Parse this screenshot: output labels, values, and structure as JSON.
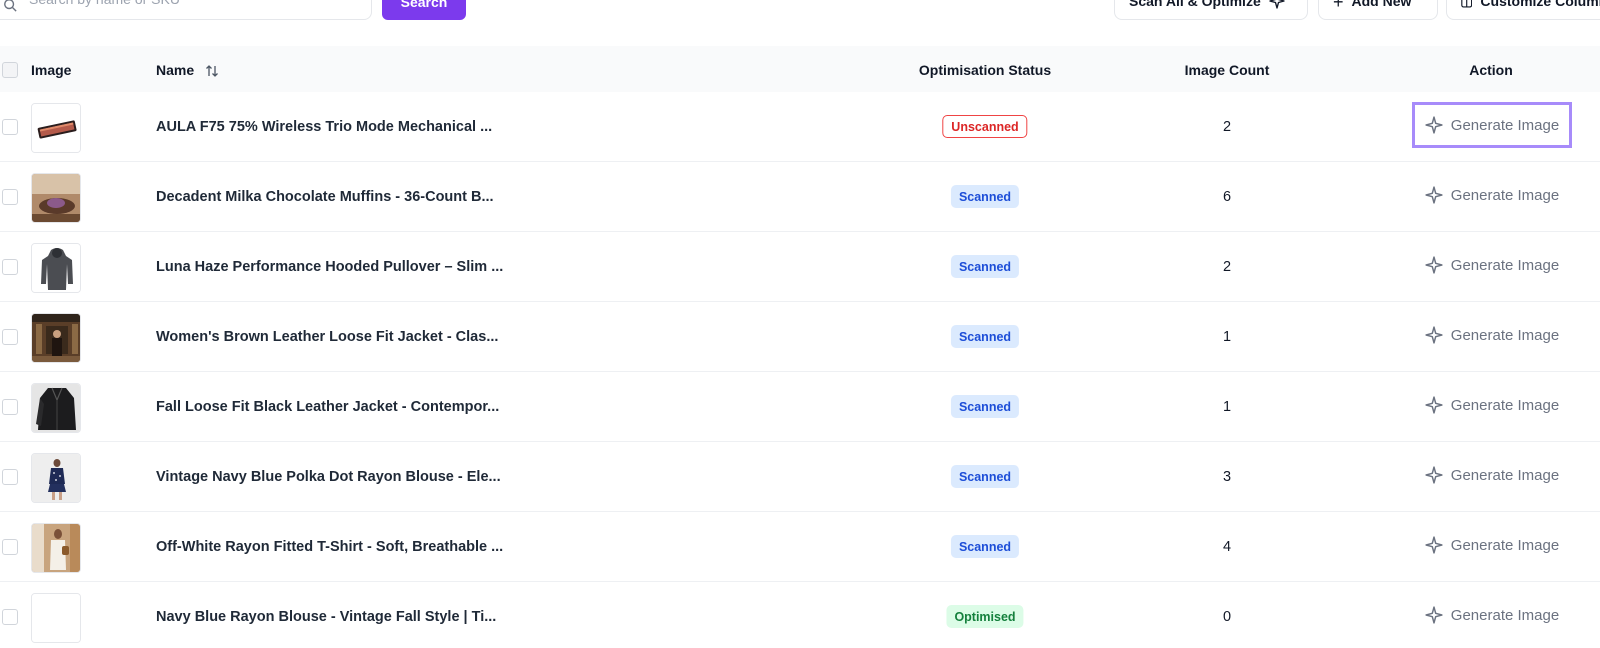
{
  "toolbar": {
    "search_placeholder": "Search by name or SKU",
    "search_button": "Search",
    "scan_all_button": "Scan All & Optimize",
    "add_new_button": "Add New",
    "customize_button": "Customize Columns"
  },
  "table": {
    "headers": {
      "image": "Image",
      "name": "Name",
      "status": "Optimisation Status",
      "count": "Image Count",
      "action": "Action"
    },
    "rows": [
      {
        "name": "AULA F75 75% Wireless Trio Mode Mechanical ...",
        "status": "Unscanned",
        "count": "2",
        "action": "Generate Image",
        "thumb": "keyboard"
      },
      {
        "name": "Decadent Milka Chocolate Muffins - 36-Count B...",
        "status": "Scanned",
        "count": "6",
        "action": "Generate Image",
        "thumb": "muffins"
      },
      {
        "name": "Luna Haze Performance Hooded Pullover – Slim ...",
        "status": "Scanned",
        "count": "2",
        "action": "Generate Image",
        "thumb": "hoodie"
      },
      {
        "name": "Women's Brown Leather Loose Fit Jacket - Clas...",
        "status": "Scanned",
        "count": "1",
        "action": "Generate Image",
        "thumb": "store"
      },
      {
        "name": "Fall Loose Fit Black Leather Jacket - Contempor...",
        "status": "Scanned",
        "count": "1",
        "action": "Generate Image",
        "thumb": "jacket"
      },
      {
        "name": "Vintage Navy Blue Polka Dot Rayon Blouse - Ele...",
        "status": "Scanned",
        "count": "3",
        "action": "Generate Image",
        "thumb": "blouse"
      },
      {
        "name": "Off-White Rayon Fitted T-Shirt - Soft, Breathable ...",
        "status": "Scanned",
        "count": "4",
        "action": "Generate Image",
        "thumb": "tshirt"
      },
      {
        "name": "Navy Blue Rayon Blouse - Vintage Fall Style | Ti...",
        "status": "Optimised",
        "count": "0",
        "action": "Generate Image",
        "thumb": "blank"
      }
    ]
  },
  "colors": {
    "accent": "#7c3aed",
    "focus_ring": "#a78bfa",
    "unscanned": "#dc2626",
    "scanned_bg": "#dbeafe",
    "optimised_bg": "#dcfce7"
  }
}
